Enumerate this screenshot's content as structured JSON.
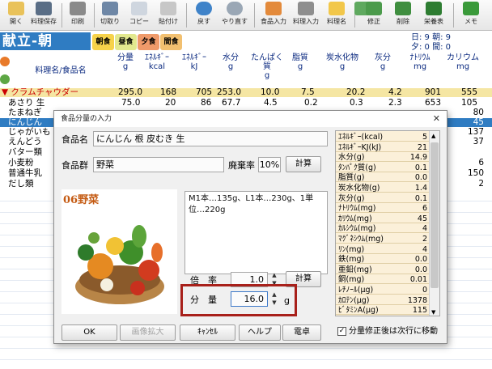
{
  "toolbar": {
    "items": [
      {
        "label": "開く",
        "icon": "folder-open-icon"
      },
      {
        "label": "料理保存",
        "icon": "save-icon"
      },
      {
        "label": "印刷",
        "icon": "printer-icon"
      },
      {
        "label": "切取り",
        "icon": "scissors-icon"
      },
      {
        "label": "コピー",
        "icon": "copy-icon"
      },
      {
        "label": "貼付け",
        "icon": "paste-icon"
      },
      {
        "label": "戻す",
        "icon": "undo-icon"
      },
      {
        "label": "やり直す",
        "icon": "redo-icon"
      },
      {
        "label": "食品入力",
        "icon": "food-input-icon"
      },
      {
        "label": "料理入力",
        "icon": "fork-knife-icon"
      },
      {
        "label": "料理名",
        "icon": "cook-card-icon"
      },
      {
        "label": "",
        "icon": "person-icon"
      },
      {
        "label": "修正",
        "icon": "edit-person-icon"
      },
      {
        "label": "削除",
        "icon": "delete-icon"
      },
      {
        "label": "栄養表",
        "icon": "nutrition-table-icon"
      },
      {
        "label": "メモ",
        "icon": "memo-icon"
      }
    ]
  },
  "kondate_label": "献立-朝",
  "meals": [
    "朝食",
    "昼食",
    "夕食",
    "間食"
  ],
  "summary": {
    "line1": "日: 9 朝: 9",
    "line2": "夕: 0 間: 0"
  },
  "columns": [
    "料理名/食品名",
    "分量\ng",
    "ｴﾈﾙｷﾞｰ\nkcal",
    "ｴﾈﾙｷﾞｰ\nkJ",
    "水分\ng",
    "たんぱく\n質\ng",
    "脂質\ng",
    "炭水化物\ng",
    "灰分\ng",
    "ﾅﾄﾘｳﾑ\nmg",
    "カリウム\nmg",
    "カル"
  ],
  "rows": [
    {
      "name": "▼ クラムチャウダー",
      "vals": [
        "295.0",
        "168",
        "705",
        "253.0",
        "10.0",
        "7.5",
        "20.2",
        "4.2",
        "901",
        "555"
      ]
    },
    {
      "name": "あさり 生",
      "vals": [
        "75.0",
        "20",
        "86",
        "67.7",
        "4.5",
        "0.2",
        "0.3",
        "2.3",
        "653",
        "105"
      ]
    },
    {
      "name": "たまねぎ"
    },
    {
      "name": "にんじん"
    },
    {
      "name": "じゃがいも"
    },
    {
      "name": "えんどう"
    },
    {
      "name": "バター類"
    },
    {
      "name": "小麦粉"
    },
    {
      "name": "普通牛乳"
    },
    {
      "name": "だし類"
    }
  ],
  "right_values": [
    "80",
    "45",
    "137",
    "37",
    "6",
    "150",
    "2"
  ],
  "dialog": {
    "title": "食品分量の入力",
    "food_name_label": "食品名",
    "food_name": "にんじん 根 皮むき 生",
    "food_group_label": "食品群",
    "food_group": "野菜",
    "waste_label": "廃棄率",
    "waste_value": "10%",
    "calc_label": "計算",
    "photo_caption": "06野菜",
    "memo": "M1本…135g、L1本…230g、1単位…220g",
    "multiplier_label": "倍　率",
    "multiplier_value": "1.0",
    "amount_label": "分　量",
    "amount_value": "16.0",
    "amount_unit": "g",
    "ok": "OK",
    "enlarge": "画像拡大",
    "cancel": "ｷｬﾝｾﾙ",
    "help": "ヘルプ",
    "calculator": "電卓",
    "checkbox_label": "分量修正後は次行に移動",
    "checkbox_checked": true,
    "nutrients": [
      {
        "name": "ｴﾈﾙｷﾞｰ(kcal)",
        "value": "5"
      },
      {
        "name": "ｴﾈﾙｷﾞｰKJ(kJ)",
        "value": "21"
      },
      {
        "name": "水分(g)",
        "value": "14.9"
      },
      {
        "name": "ﾀﾝﾊﾟｸ質(g)",
        "value": "0.1"
      },
      {
        "name": "脂質(g)",
        "value": "0.0"
      },
      {
        "name": "炭水化物(g)",
        "value": "1.4"
      },
      {
        "name": "灰分(g)",
        "value": "0.1"
      },
      {
        "name": "ﾅﾄﾘｳﾑ(mg)",
        "value": "6"
      },
      {
        "name": "ｶﾘｳﾑ(mg)",
        "value": "45"
      },
      {
        "name": "ｶﾙｼｳﾑ(mg)",
        "value": "4"
      },
      {
        "name": "ﾏｸﾞﾈｼｳﾑ(mg)",
        "value": "2"
      },
      {
        "name": "ﾘﾝ(mg)",
        "value": "4"
      },
      {
        "name": "鉄(mg)",
        "value": "0.0"
      },
      {
        "name": "亜鉛(mg)",
        "value": "0.0"
      },
      {
        "name": "銅(mg)",
        "value": "0.01"
      },
      {
        "name": "ﾚﾁﾉｰﾙ(μg)",
        "value": "0"
      },
      {
        "name": "ｶﾛﾃﾝ(μg)",
        "value": "1378"
      },
      {
        "name": "ﾋﾞﾀﾐﾝA(μg)",
        "value": "115"
      }
    ]
  },
  "colors": {
    "accent": "#2f7cc2",
    "selected_row": "#f5e6a3",
    "nutrient_bg": "#fbf0d9",
    "highlight_border": "#a8201a"
  }
}
